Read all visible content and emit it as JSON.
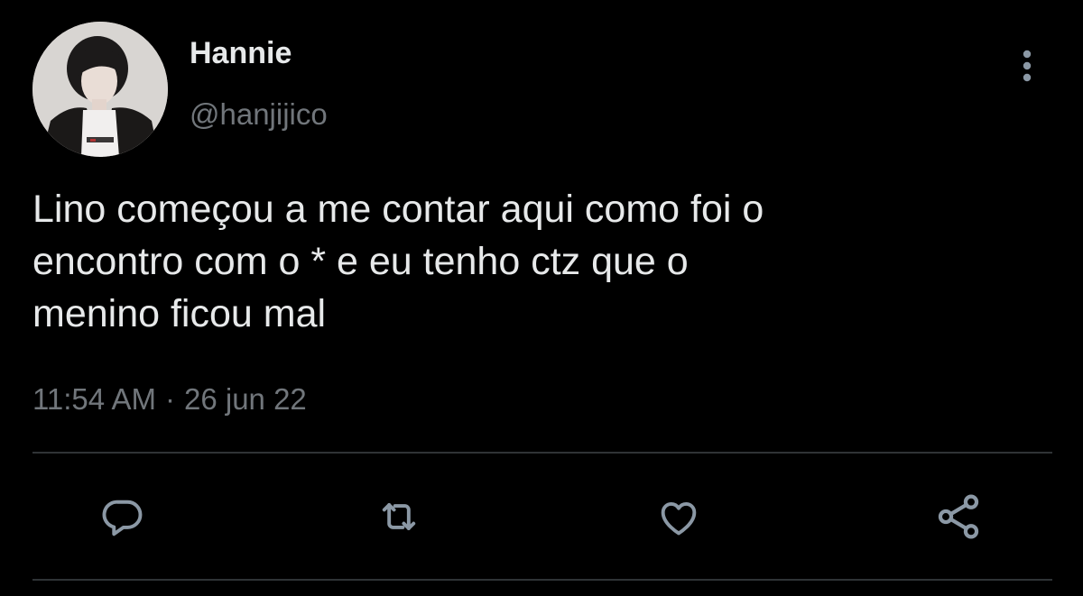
{
  "author": {
    "display_name": "Hannie",
    "handle": "@hanjijico"
  },
  "tweet": {
    "text": "Lino começou a me contar aqui como foi o\nencontro com o * e eu tenho ctz que o\nmenino ficou mal",
    "time": "11:54 AM",
    "separator": "·",
    "date": "26 jun 22"
  },
  "actions": {
    "icons": [
      "reply-icon",
      "retweet-icon",
      "like-icon",
      "share-icon"
    ]
  },
  "colors": {
    "background": "#000000",
    "primary_text": "#e7e9ea",
    "secondary_text": "#71767b",
    "icon": "#8b98a5",
    "divider": "#2f3336"
  }
}
